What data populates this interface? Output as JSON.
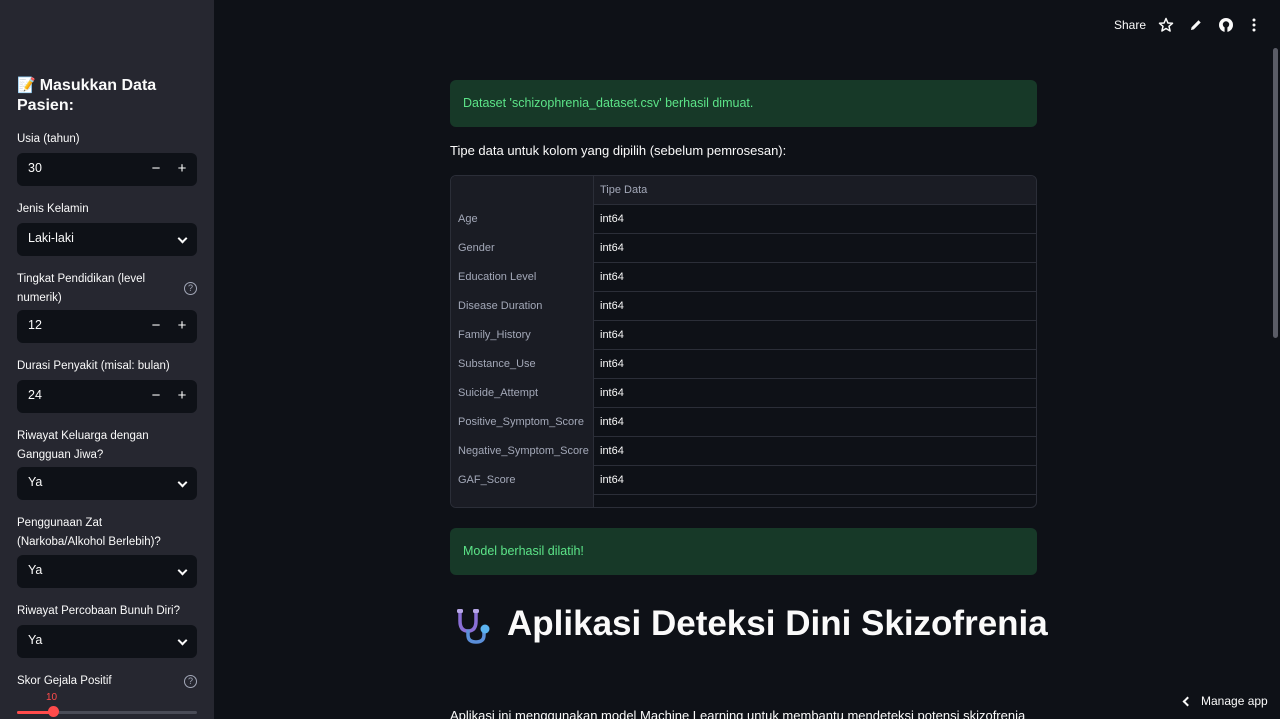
{
  "header": {
    "share_label": "Share",
    "icons": [
      "star-icon",
      "pencil-icon",
      "github-icon",
      "more-vertical-icon"
    ]
  },
  "sidebar": {
    "title_emoji": "📝",
    "title": "Masukkan Data Pasien:",
    "fields": {
      "age": {
        "label": "Usia (tahun)",
        "value": "30"
      },
      "gender": {
        "label": "Jenis Kelamin",
        "value": "Laki-laki"
      },
      "education": {
        "label": "Tingkat Pendidikan (level numerik)",
        "value": "12"
      },
      "duration": {
        "label": "Durasi Penyakit (misal: bulan)",
        "value": "24"
      },
      "family_history": {
        "label": "Riwayat Keluarga dengan Gangguan Jiwa?",
        "value": "Ya"
      },
      "substance_use": {
        "label": "Penggunaan Zat (Narkoba/Alkohol Berlebih)?",
        "value": "Ya"
      },
      "suicide_attempt": {
        "label": "Riwayat Percobaan Bunuh Diri?",
        "value": "Ya"
      },
      "positive_score": {
        "label": "Skor Gejala Positif",
        "value": "10",
        "fraction": 0.2
      }
    },
    "minus": "−",
    "plus": "+",
    "help": "?"
  },
  "main": {
    "alert_dataset": "Dataset 'schizophrenia_dataset.csv' berhasil dimuat.",
    "dtype_caption": "Tipe data untuk kolom yang dipilih (sebelum pemrosesan):",
    "table": {
      "header": [
        "",
        "Tipe Data"
      ],
      "rows": [
        [
          "Age",
          "int64"
        ],
        [
          "Gender",
          "int64"
        ],
        [
          "Education Level",
          "int64"
        ],
        [
          "Disease Duration",
          "int64"
        ],
        [
          "Family_History",
          "int64"
        ],
        [
          "Substance_Use",
          "int64"
        ],
        [
          "Suicide_Attempt",
          "int64"
        ],
        [
          "Positive_Symptom_Score",
          "int64"
        ],
        [
          "Negative_Symptom_Score",
          "int64"
        ],
        [
          "GAF_Score",
          "int64"
        ]
      ]
    },
    "alert_model": "Model berhasil dilatih!",
    "app_title": "Aplikasi Deteksi Dini Skizofrenia",
    "description": "Aplikasi ini menggunakan model Machine Learning untuk membantu mendeteksi potensi skizofrenia"
  },
  "manage_app": "Manage app",
  "colors": {
    "background": "#0e1117",
    "sidebar": "#262730",
    "success_bg": "#173928",
    "success_text": "#5ce488",
    "accent": "#ff4b4b"
  }
}
